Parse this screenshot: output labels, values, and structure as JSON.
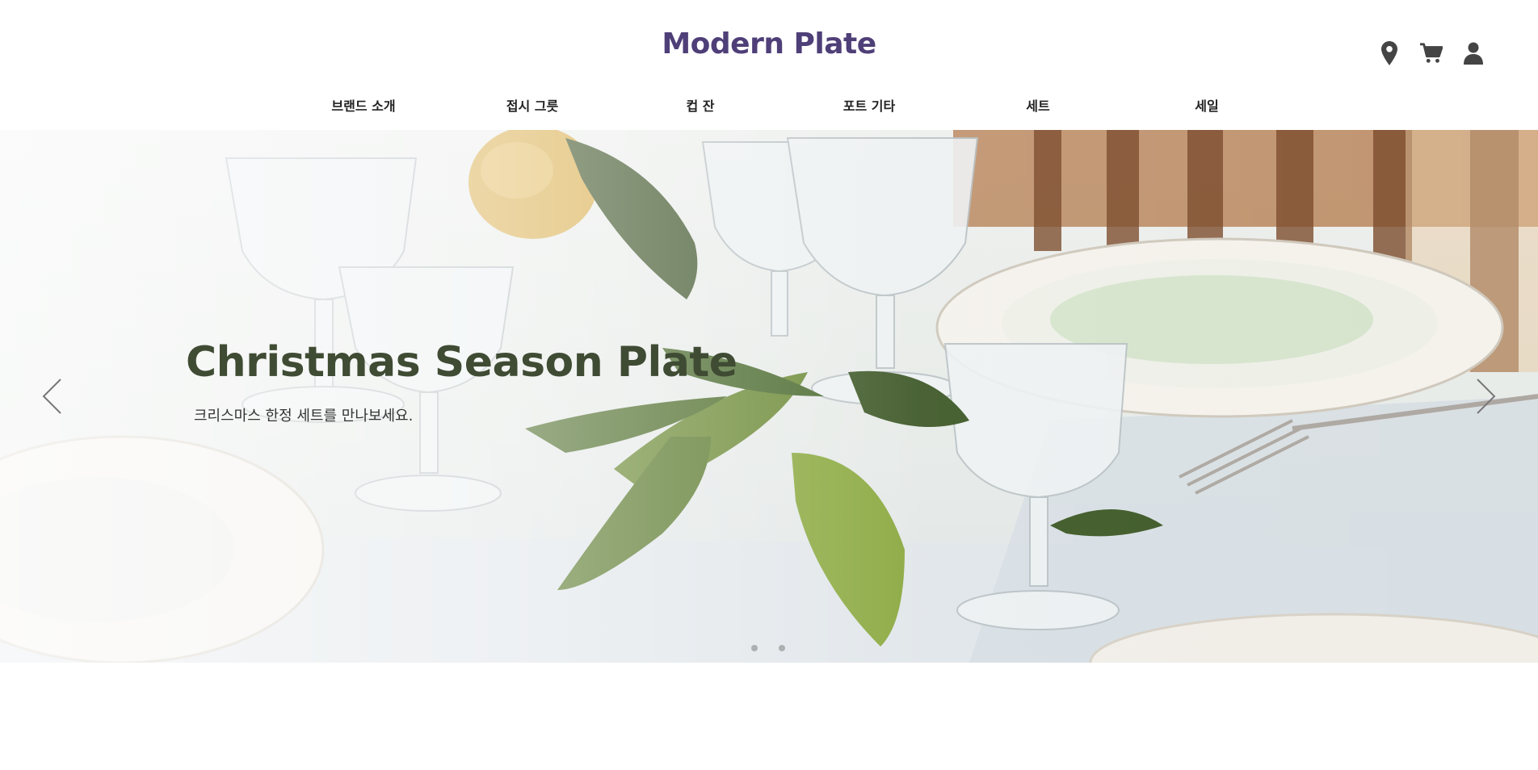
{
  "brand": {
    "logo": "Modern Plate",
    "color": "#4f3f78"
  },
  "utils": [
    {
      "icon": "map-marker-icon",
      "label": "location"
    },
    {
      "icon": "cart-icon",
      "label": "cart"
    },
    {
      "icon": "user-icon",
      "label": "account"
    }
  ],
  "nav": {
    "items": [
      {
        "label": "브랜드 소개"
      },
      {
        "label": "접시 그릇"
      },
      {
        "label": "컵 잔"
      },
      {
        "label": "포트 기타"
      },
      {
        "label": "세트"
      },
      {
        "label": "세일"
      }
    ]
  },
  "hero": {
    "title": "Christmas Season Plate",
    "subtitle": "크리스마스 한정 세트를 만나보세요.",
    "title_color": "#3f4b33",
    "subtitle_color": "#333333",
    "prev_icon": "chevron-left-icon",
    "next_icon": "chevron-right-icon",
    "slide_count": 2
  },
  "colors": {
    "icon": "#444444",
    "nav_text": "#222222"
  }
}
